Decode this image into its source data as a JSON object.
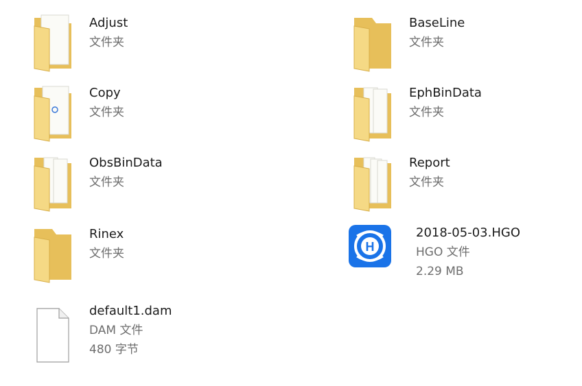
{
  "items": [
    {
      "name": "Adjust",
      "type": "文件夹",
      "icon": "folder-icon"
    },
    {
      "name": "BaseLine",
      "type": "文件夹",
      "icon": "folder-icon"
    },
    {
      "name": "Copy",
      "type": "文件夹",
      "icon": "folder-icon"
    },
    {
      "name": "EphBinData",
      "type": "文件夹",
      "icon": "folder-icon"
    },
    {
      "name": "ObsBinData",
      "type": "文件夹",
      "icon": "folder-icon"
    },
    {
      "name": "Report",
      "type": "文件夹",
      "icon": "folder-icon"
    },
    {
      "name": "Rinex",
      "type": "文件夹",
      "icon": "folder-icon"
    },
    {
      "name": "2018-05-03.HGO",
      "type": "HGO 文件",
      "size": "2.29 MB",
      "icon": "hgo-app-icon"
    },
    {
      "name": "default1.dam",
      "type": "DAM 文件",
      "size": "480 字节",
      "icon": "blank-file-icon"
    }
  ],
  "colors": {
    "folder": "#f3d27a",
    "folder_dark": "#e0b24a",
    "hgo_blue": "#1a73e8",
    "meta_text": "#6d6d6d"
  }
}
